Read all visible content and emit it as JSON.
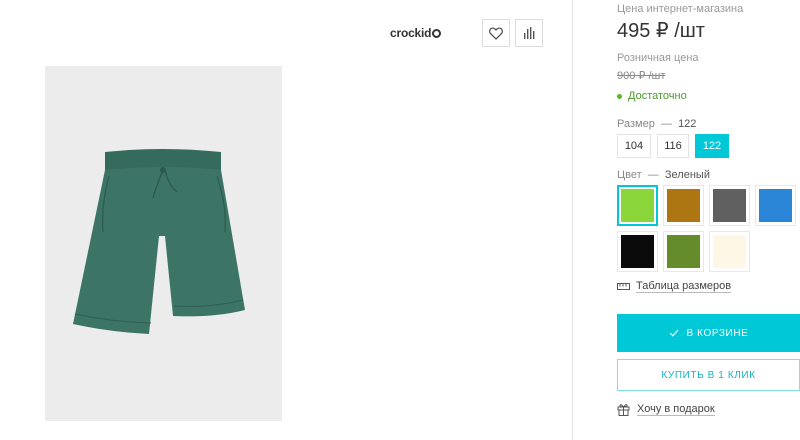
{
  "header": {
    "brand": "crockid",
    "favorite_icon": "heart-icon",
    "compare_icon": "bar-chart-icon"
  },
  "product": {
    "image_alt_icon": "shorts-image",
    "colors": {
      "shorts": "#3c7566",
      "background": "#ececec"
    }
  },
  "price": {
    "online_label": "Цена интернет-магазина",
    "online_value": "495 ₽ /шт",
    "retail_label": "Розничная цена",
    "retail_value": "900 ₽ /шт",
    "stock_text": "Достаточно"
  },
  "size": {
    "label": "Размер",
    "dash": "—",
    "selected": "122",
    "options": [
      "104",
      "116",
      "122"
    ]
  },
  "color": {
    "label": "Цвет",
    "dash": "—",
    "selected": "Зеленый",
    "swatches": [
      "#8bd63a",
      "#ad7612",
      "#606060",
      "#2a85d6",
      "#0a0a0a",
      "#648c2a",
      "#fff7e6"
    ]
  },
  "links": {
    "size_table": "Таблица размеров",
    "gift": "Хочу в подарок"
  },
  "buttons": {
    "cart": "В КОРЗИНЕ",
    "one_click": "КУПИТЬ В 1 КЛИК"
  },
  "accent": "#00c8d7"
}
